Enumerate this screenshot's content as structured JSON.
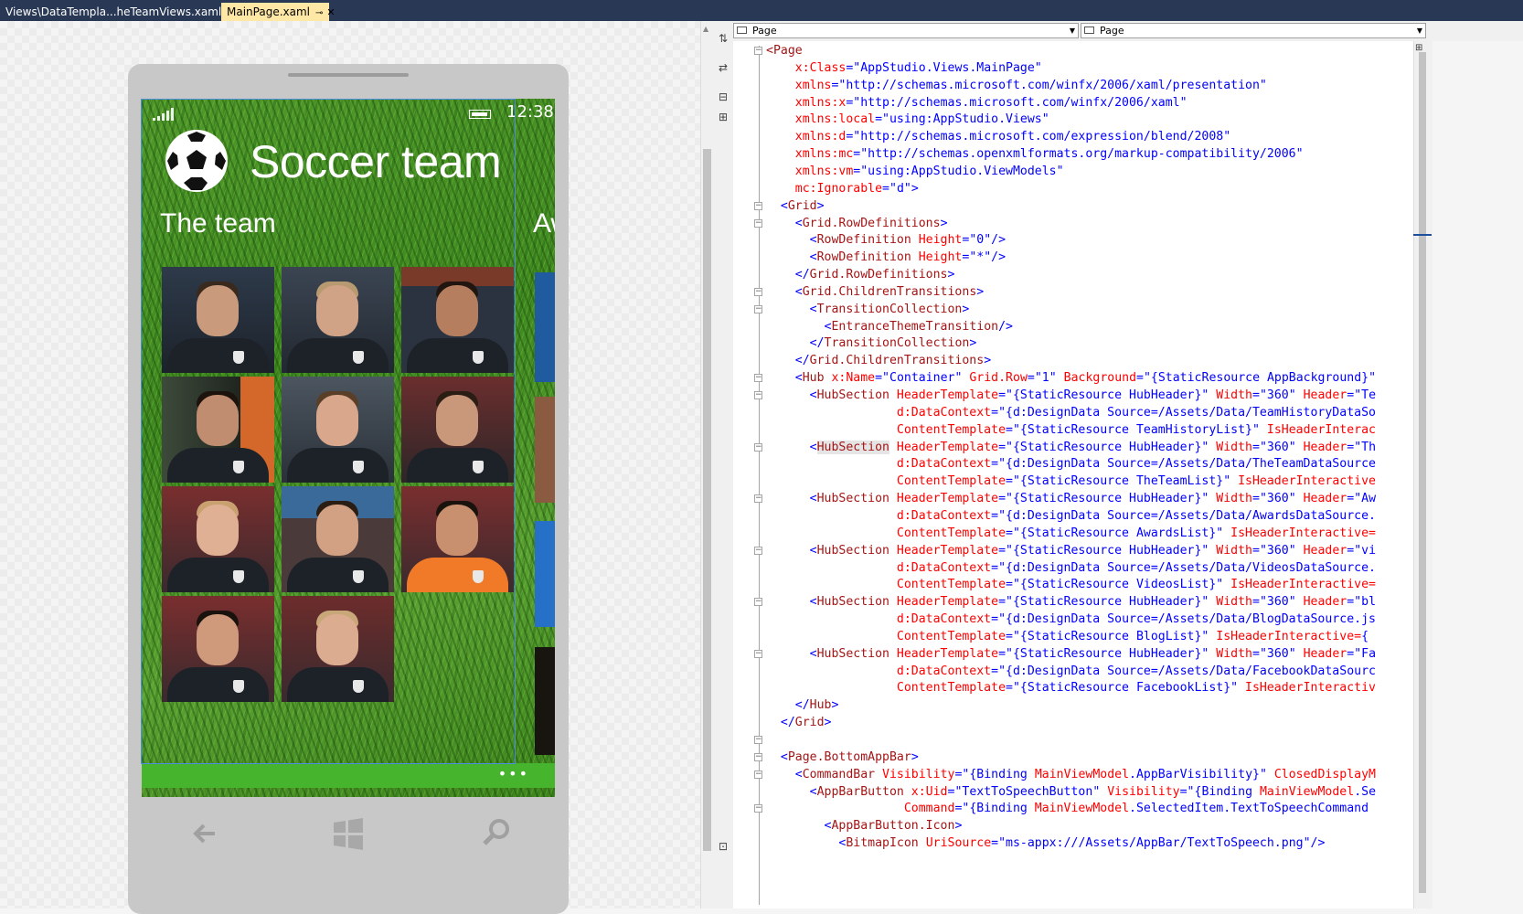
{
  "tabs": [
    {
      "label": "Views\\DataTempla...heTeamViews.xaml",
      "active": false
    },
    {
      "label": "MainPage.xaml",
      "active": true,
      "pin": "⊸",
      "close": "✕"
    }
  ],
  "phone": {
    "time": "12:38",
    "app_title": "Soccer team",
    "section_header": "The team",
    "next_section_header": "Aw",
    "appbar_dots": "•••",
    "players": 11
  },
  "editor": {
    "left_dropdown": "Page",
    "right_dropdown": "Page"
  },
  "code": [
    [
      [
        "t",
        "<Page"
      ]
    ],
    [
      [
        "a",
        "    x:Class"
      ],
      [
        "p",
        "=\""
      ],
      [
        "v",
        "AppStudio.Views.MainPage"
      ],
      [
        "p",
        "\""
      ]
    ],
    [
      [
        "a",
        "    xmlns"
      ],
      [
        "p",
        "=\""
      ],
      [
        "v",
        "http://schemas.microsoft.com/winfx/2006/xaml/presentation"
      ],
      [
        "p",
        "\""
      ]
    ],
    [
      [
        "a",
        "    xmlns:x"
      ],
      [
        "p",
        "=\""
      ],
      [
        "v",
        "http://schemas.microsoft.com/winfx/2006/xaml"
      ],
      [
        "p",
        "\""
      ]
    ],
    [
      [
        "a",
        "    xmlns:local"
      ],
      [
        "p",
        "=\""
      ],
      [
        "v",
        "using:AppStudio.Views"
      ],
      [
        "p",
        "\""
      ]
    ],
    [
      [
        "a",
        "    xmlns:d"
      ],
      [
        "p",
        "=\""
      ],
      [
        "v",
        "http://schemas.microsoft.com/expression/blend/2008"
      ],
      [
        "p",
        "\""
      ]
    ],
    [
      [
        "a",
        "    xmlns:mc"
      ],
      [
        "p",
        "=\""
      ],
      [
        "v",
        "http://schemas.openxmlformats.org/markup-compatibility/2006"
      ],
      [
        "p",
        "\""
      ]
    ],
    [
      [
        "a",
        "    xmlns:vm"
      ],
      [
        "p",
        "=\""
      ],
      [
        "v",
        "using:AppStudio.ViewModels"
      ],
      [
        "p",
        "\""
      ]
    ],
    [
      [
        "a",
        "    mc:Ignorable"
      ],
      [
        "p",
        "=\""
      ],
      [
        "v",
        "d"
      ],
      [
        "p",
        "\">"
      ]
    ],
    [
      [
        "p",
        "  <"
      ],
      [
        "t",
        "Grid"
      ],
      [
        "p",
        ">"
      ]
    ],
    [
      [
        "p",
        "    <"
      ],
      [
        "t",
        "Grid.RowDefinitions"
      ],
      [
        "p",
        ">"
      ]
    ],
    [
      [
        "p",
        "      <"
      ],
      [
        "t",
        "RowDefinition"
      ],
      [
        "a",
        " Height"
      ],
      [
        "p",
        "=\""
      ],
      [
        "v",
        "0"
      ],
      [
        "p",
        "\"/>"
      ]
    ],
    [
      [
        "p",
        "      <"
      ],
      [
        "t",
        "RowDefinition"
      ],
      [
        "a",
        " Height"
      ],
      [
        "p",
        "=\""
      ],
      [
        "v",
        "*"
      ],
      [
        "p",
        "\"/>"
      ]
    ],
    [
      [
        "p",
        "    </"
      ],
      [
        "t",
        "Grid.RowDefinitions"
      ],
      [
        "p",
        ">"
      ]
    ],
    [
      [
        "p",
        "    <"
      ],
      [
        "t",
        "Grid.ChildrenTransitions"
      ],
      [
        "p",
        ">"
      ]
    ],
    [
      [
        "p",
        "      <"
      ],
      [
        "t",
        "TransitionCollection"
      ],
      [
        "p",
        ">"
      ]
    ],
    [
      [
        "p",
        "        <"
      ],
      [
        "t",
        "EntranceThemeTransition"
      ],
      [
        "p",
        "/>"
      ]
    ],
    [
      [
        "p",
        "      </"
      ],
      [
        "t",
        "TransitionCollection"
      ],
      [
        "p",
        ">"
      ]
    ],
    [
      [
        "p",
        "    </"
      ],
      [
        "t",
        "Grid.ChildrenTransitions"
      ],
      [
        "p",
        ">"
      ]
    ],
    [
      [
        "p",
        "    <"
      ],
      [
        "t",
        "Hub"
      ],
      [
        "a",
        " x:Name"
      ],
      [
        "p",
        "=\""
      ],
      [
        "v",
        "Container"
      ],
      [
        "p",
        "\""
      ],
      [
        "a",
        " Grid.Row"
      ],
      [
        "p",
        "=\""
      ],
      [
        "v",
        "1"
      ],
      [
        "p",
        "\""
      ],
      [
        "a",
        " Background"
      ],
      [
        "p",
        "=\""
      ],
      [
        "v",
        "{StaticResource AppBackground}"
      ],
      [
        "p",
        "\""
      ]
    ],
    [
      [
        "p",
        "      <"
      ],
      [
        "t",
        "HubSection"
      ],
      [
        "a",
        " HeaderTemplate"
      ],
      [
        "p",
        "=\""
      ],
      [
        "v",
        "{StaticResource HubHeader}"
      ],
      [
        "p",
        "\""
      ],
      [
        "a",
        " Width"
      ],
      [
        "p",
        "=\""
      ],
      [
        "v",
        "360"
      ],
      [
        "p",
        "\""
      ],
      [
        "a",
        " Header"
      ],
      [
        "p",
        "=\""
      ],
      [
        "v",
        "Te"
      ]
    ],
    [
      [
        "a",
        "                  d:DataContext"
      ],
      [
        "p",
        "=\""
      ],
      [
        "v",
        "{d:DesignData Source=/Assets/Data/TeamHistoryDataSo"
      ]
    ],
    [
      [
        "a",
        "                  ContentTemplate"
      ],
      [
        "p",
        "=\""
      ],
      [
        "v",
        "{StaticResource TeamHistoryList}"
      ],
      [
        "p",
        "\""
      ],
      [
        "a",
        " IsHeaderInterac"
      ]
    ],
    [
      [
        "p",
        "      <"
      ],
      [
        "t",
        "HubSection",
        "hl"
      ],
      [
        "a",
        " HeaderTemplate"
      ],
      [
        "p",
        "=\""
      ],
      [
        "v",
        "{StaticResource HubHeader}"
      ],
      [
        "p",
        "\""
      ],
      [
        "a",
        " Width"
      ],
      [
        "p",
        "=\""
      ],
      [
        "v",
        "360"
      ],
      [
        "p",
        "\""
      ],
      [
        "a",
        " Header"
      ],
      [
        "p",
        "=\""
      ],
      [
        "v",
        "Th"
      ]
    ],
    [
      [
        "a",
        "                  d:DataContext"
      ],
      [
        "p",
        "=\""
      ],
      [
        "v",
        "{d:DesignData Source=/Assets/Data/TheTeamDataSource"
      ]
    ],
    [
      [
        "a",
        "                  ContentTemplate"
      ],
      [
        "p",
        "=\""
      ],
      [
        "v",
        "{StaticResource TheTeamList}"
      ],
      [
        "p",
        "\""
      ],
      [
        "a",
        " IsHeaderInteractive"
      ]
    ],
    [
      [
        "p",
        "      <"
      ],
      [
        "t",
        "HubSection"
      ],
      [
        "a",
        " HeaderTemplate"
      ],
      [
        "p",
        "=\""
      ],
      [
        "v",
        "{StaticResource HubHeader}"
      ],
      [
        "p",
        "\""
      ],
      [
        "a",
        " Width"
      ],
      [
        "p",
        "=\""
      ],
      [
        "v",
        "360"
      ],
      [
        "p",
        "\""
      ],
      [
        "a",
        " Header"
      ],
      [
        "p",
        "=\""
      ],
      [
        "v",
        "Aw"
      ]
    ],
    [
      [
        "a",
        "                  d:DataContext"
      ],
      [
        "p",
        "=\""
      ],
      [
        "v",
        "{d:DesignData Source=/Assets/Data/AwardsDataSource."
      ]
    ],
    [
      [
        "a",
        "                  ContentTemplate"
      ],
      [
        "p",
        "=\""
      ],
      [
        "v",
        "{StaticResource AwardsList}"
      ],
      [
        "p",
        "\""
      ],
      [
        "a",
        " IsHeaderInteractive="
      ]
    ],
    [
      [
        "p",
        "      <"
      ],
      [
        "t",
        "HubSection"
      ],
      [
        "a",
        " HeaderTemplate"
      ],
      [
        "p",
        "=\""
      ],
      [
        "v",
        "{StaticResource HubHeader}"
      ],
      [
        "p",
        "\""
      ],
      [
        "a",
        " Width"
      ],
      [
        "p",
        "=\""
      ],
      [
        "v",
        "360"
      ],
      [
        "p",
        "\""
      ],
      [
        "a",
        " Header"
      ],
      [
        "p",
        "=\""
      ],
      [
        "v",
        "vi"
      ]
    ],
    [
      [
        "a",
        "                  d:DataContext"
      ],
      [
        "p",
        "=\""
      ],
      [
        "v",
        "{d:DesignData Source=/Assets/Data/VideosDataSource."
      ]
    ],
    [
      [
        "a",
        "                  ContentTemplate"
      ],
      [
        "p",
        "=\""
      ],
      [
        "v",
        "{StaticResource VideosList}"
      ],
      [
        "p",
        "\""
      ],
      [
        "a",
        " IsHeaderInteractive="
      ]
    ],
    [
      [
        "p",
        "      <"
      ],
      [
        "t",
        "HubSection"
      ],
      [
        "a",
        " HeaderTemplate"
      ],
      [
        "p",
        "=\""
      ],
      [
        "v",
        "{StaticResource HubHeader}"
      ],
      [
        "p",
        "\""
      ],
      [
        "a",
        " Width"
      ],
      [
        "p",
        "=\""
      ],
      [
        "v",
        "360"
      ],
      [
        "p",
        "\""
      ],
      [
        "a",
        " Header"
      ],
      [
        "p",
        "=\""
      ],
      [
        "v",
        "bl"
      ]
    ],
    [
      [
        "a",
        "                  d:DataContext"
      ],
      [
        "p",
        "=\""
      ],
      [
        "v",
        "{d:DesignData Source=/Assets/Data/BlogDataSource.js"
      ]
    ],
    [
      [
        "a",
        "                  ContentTemplate"
      ],
      [
        "p",
        "=\""
      ],
      [
        "v",
        "{StaticResource BlogList}"
      ],
      [
        "p",
        "\""
      ],
      [
        "a",
        " IsHeaderInteractive="
      ],
      [
        "v",
        "{"
      ]
    ],
    [
      [
        "p",
        "      <"
      ],
      [
        "t",
        "HubSection"
      ],
      [
        "a",
        " HeaderTemplate"
      ],
      [
        "p",
        "=\""
      ],
      [
        "v",
        "{StaticResource HubHeader}"
      ],
      [
        "p",
        "\""
      ],
      [
        "a",
        " Width"
      ],
      [
        "p",
        "=\""
      ],
      [
        "v",
        "360"
      ],
      [
        "p",
        "\""
      ],
      [
        "a",
        " Header"
      ],
      [
        "p",
        "=\""
      ],
      [
        "v",
        "Fa"
      ]
    ],
    [
      [
        "a",
        "                  d:DataContext"
      ],
      [
        "p",
        "=\""
      ],
      [
        "v",
        "{d:DesignData Source=/Assets/Data/FacebookDataSourc"
      ]
    ],
    [
      [
        "a",
        "                  ContentTemplate"
      ],
      [
        "p",
        "=\""
      ],
      [
        "v",
        "{StaticResource FacebookList}"
      ],
      [
        "p",
        "\""
      ],
      [
        "a",
        " IsHeaderInteractiv"
      ]
    ],
    [
      [
        "p",
        "    </"
      ],
      [
        "t",
        "Hub"
      ],
      [
        "p",
        ">"
      ]
    ],
    [
      [
        "p",
        "  </"
      ],
      [
        "t",
        "Grid"
      ],
      [
        "p",
        ">"
      ]
    ],
    [],
    [
      [
        "p",
        "  <"
      ],
      [
        "t",
        "Page.BottomAppBar"
      ],
      [
        "p",
        ">"
      ]
    ],
    [
      [
        "p",
        "    <"
      ],
      [
        "t",
        "CommandBar"
      ],
      [
        "a",
        " Visibility"
      ],
      [
        "p",
        "=\""
      ],
      [
        "v",
        "{Binding "
      ],
      [
        "a",
        "MainViewModel"
      ],
      [
        "v",
        ".AppBarVisibility}"
      ],
      [
        "p",
        "\""
      ],
      [
        "a",
        " ClosedDisplayM"
      ]
    ],
    [
      [
        "p",
        "      <"
      ],
      [
        "t",
        "AppBarButton"
      ],
      [
        "a",
        " x:Uid"
      ],
      [
        "p",
        "=\""
      ],
      [
        "v",
        "TextToSpeechButton"
      ],
      [
        "p",
        "\""
      ],
      [
        "a",
        " Visibility"
      ],
      [
        "p",
        "=\""
      ],
      [
        "v",
        "{Binding "
      ],
      [
        "a",
        "MainViewModel"
      ],
      [
        "v",
        ".Se"
      ]
    ],
    [
      [
        "a",
        "                   Command"
      ],
      [
        "p",
        "=\""
      ],
      [
        "v",
        "{Binding "
      ],
      [
        "a",
        "MainViewModel"
      ],
      [
        "v",
        ".SelectedItem.TextToSpeechCommand"
      ]
    ],
    [
      [
        "p",
        "        <"
      ],
      [
        "t",
        "AppBarButton.Icon"
      ],
      [
        "p",
        ">"
      ]
    ],
    [
      [
        "p",
        "          <"
      ],
      [
        "t",
        "BitmapIcon"
      ],
      [
        "a",
        " UriSource"
      ],
      [
        "p",
        "=\""
      ],
      [
        "v",
        "ms-appx:///Assets/AppBar/TextToSpeech.png"
      ],
      [
        "p",
        "\"/>"
      ]
    ]
  ]
}
